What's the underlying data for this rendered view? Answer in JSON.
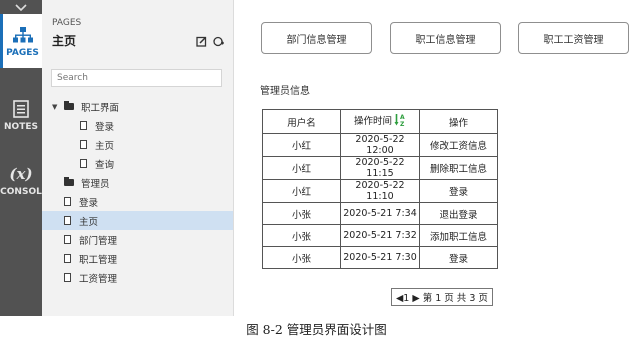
{
  "rail": {
    "pages_label": "PAGES",
    "notes_label": "NOTES",
    "console_label": "CONSOL",
    "console_glyph": "(x)"
  },
  "panel": {
    "header_label": "PAGES",
    "current_page": "主页",
    "search_placeholder": "Search",
    "tree": [
      {
        "label": "职工界面",
        "type": "folder",
        "level": 0,
        "expanded": true
      },
      {
        "label": "登录",
        "type": "page",
        "level": 1
      },
      {
        "label": "主页",
        "type": "page",
        "level": 1
      },
      {
        "label": "查询",
        "type": "page",
        "level": 1
      },
      {
        "label": "管理员",
        "type": "folder",
        "level": 0
      },
      {
        "label": "登录",
        "type": "page",
        "level": 0
      },
      {
        "label": "主页",
        "type": "page",
        "level": 0,
        "selected": true
      },
      {
        "label": "部门管理",
        "type": "page",
        "level": 0
      },
      {
        "label": "职工管理",
        "type": "page",
        "level": 0
      },
      {
        "label": "工资管理",
        "type": "page",
        "level": 0
      }
    ]
  },
  "main": {
    "nav_buttons": [
      "部门信息管理",
      "职工信息管理",
      "职工工资管理"
    ],
    "section_title": "管理员信息",
    "table": {
      "headers": [
        "用户名",
        "操作时间",
        "操作"
      ],
      "rows": [
        [
          "小红",
          "2020-5-22 12:00",
          "修改工资信息"
        ],
        [
          "小红",
          "2020-5-22 11:15",
          "删除职工信息"
        ],
        [
          "小红",
          "2020-5-22 11:10",
          "登录"
        ],
        [
          "小张",
          "2020-5-21 7:34",
          "退出登录"
        ],
        [
          "小张",
          "2020-5-21 7:32",
          "添加职工信息"
        ],
        [
          "小张",
          "2020-5-21 7:30",
          "登录"
        ]
      ]
    },
    "pager": "◀1 ▶ 第 1 页 共 3 页"
  },
  "caption": "图 8-2  管理员界面设计图",
  "colors": {
    "rail_bg": "#525252",
    "accent": "#1b6fb8",
    "sort_icon": "#2e9e3e",
    "selected_row": "#cfe0f2"
  }
}
